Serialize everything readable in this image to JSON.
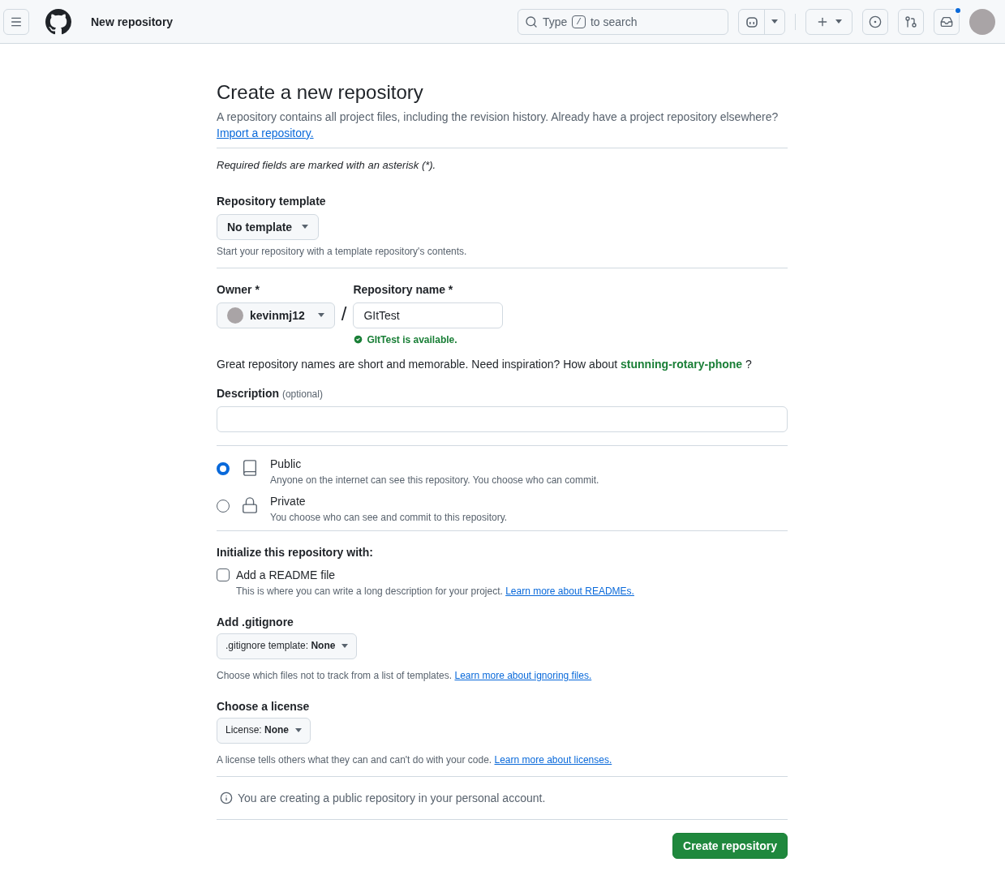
{
  "header": {
    "title": "New repository",
    "search": {
      "before": "Type",
      "key": "/",
      "after": "to search"
    },
    "inbox_unread": true
  },
  "page": {
    "title": "Create a new repository",
    "intro": "A repository contains all project files, including the revision history. Already have a project repository elsewhere?",
    "import_link": "Import a repository.",
    "required_note": "Required fields are marked with an asterisk (*)."
  },
  "template": {
    "label": "Repository template",
    "button": "No template",
    "hint": "Start your repository with a template repository's contents."
  },
  "owner": {
    "label": "Owner *",
    "value": "kevinmj12"
  },
  "separator": "/",
  "repo_name": {
    "label": "Repository name *",
    "value": "GItTest",
    "status": "GItTest is available."
  },
  "suggestion": {
    "before": "Great repository names are short and memorable. Need inspiration? How about",
    "name": "stunning-rotary-phone",
    "after": "?"
  },
  "description": {
    "label": "Description",
    "optional": "(optional)"
  },
  "visibility": [
    {
      "kind": "public",
      "label": "Public",
      "hint": "Anyone on the internet can see this repository. You choose who can commit.",
      "selected": true
    },
    {
      "kind": "private",
      "label": "Private",
      "hint": "You choose who can see and commit to this repository.",
      "selected": false
    }
  ],
  "initialize": {
    "heading": "Initialize this repository with:",
    "readme": {
      "label": "Add a README file",
      "checked": false,
      "hint": "This is where you can write a long description for your project.",
      "link": "Learn more about READMEs."
    }
  },
  "gitignore": {
    "heading": "Add .gitignore",
    "button_label": ".gitignore template:",
    "button_value": "None",
    "hint": "Choose which files not to track from a list of templates.",
    "link": "Learn more about ignoring files."
  },
  "license": {
    "heading": "Choose a license",
    "button_label": "License:",
    "button_value": "None",
    "hint": "A license tells others what they can and can't do with your code.",
    "link": "Learn more about licenses."
  },
  "notice": "You are creating a public repository in your personal account.",
  "submit": "Create repository"
}
